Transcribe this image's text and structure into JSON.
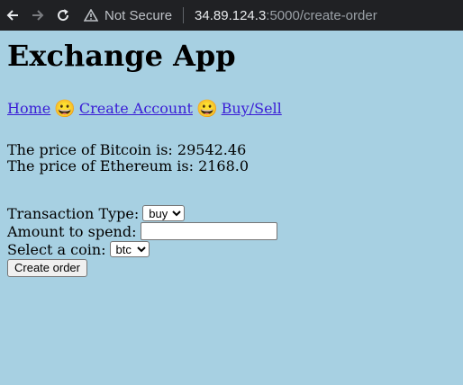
{
  "browser": {
    "security_label": "Not Secure",
    "url_host": "34.89.124.3",
    "url_path": ":5000/create-order",
    "icons": [
      "back-arrow-icon",
      "forward-arrow-icon",
      "reload-icon",
      "warning-icon"
    ]
  },
  "page": {
    "title": "Exchange App",
    "nav": {
      "home": "Home",
      "create_account": "Create Account",
      "buy_sell": "Buy/Sell",
      "separator_emoji": "😀"
    },
    "prices": {
      "bitcoin": "The price of Bitcoin is: 29542.46",
      "ethereum": "The price of Ethereum is: 2168.0"
    },
    "form": {
      "transaction_type_label": "Transaction Type:",
      "transaction_type_value": "buy",
      "amount_label": "Amount to spend:",
      "amount_value": "",
      "coin_label": "Select a coin:",
      "coin_value": "btc",
      "submit_label": "Create order"
    }
  }
}
